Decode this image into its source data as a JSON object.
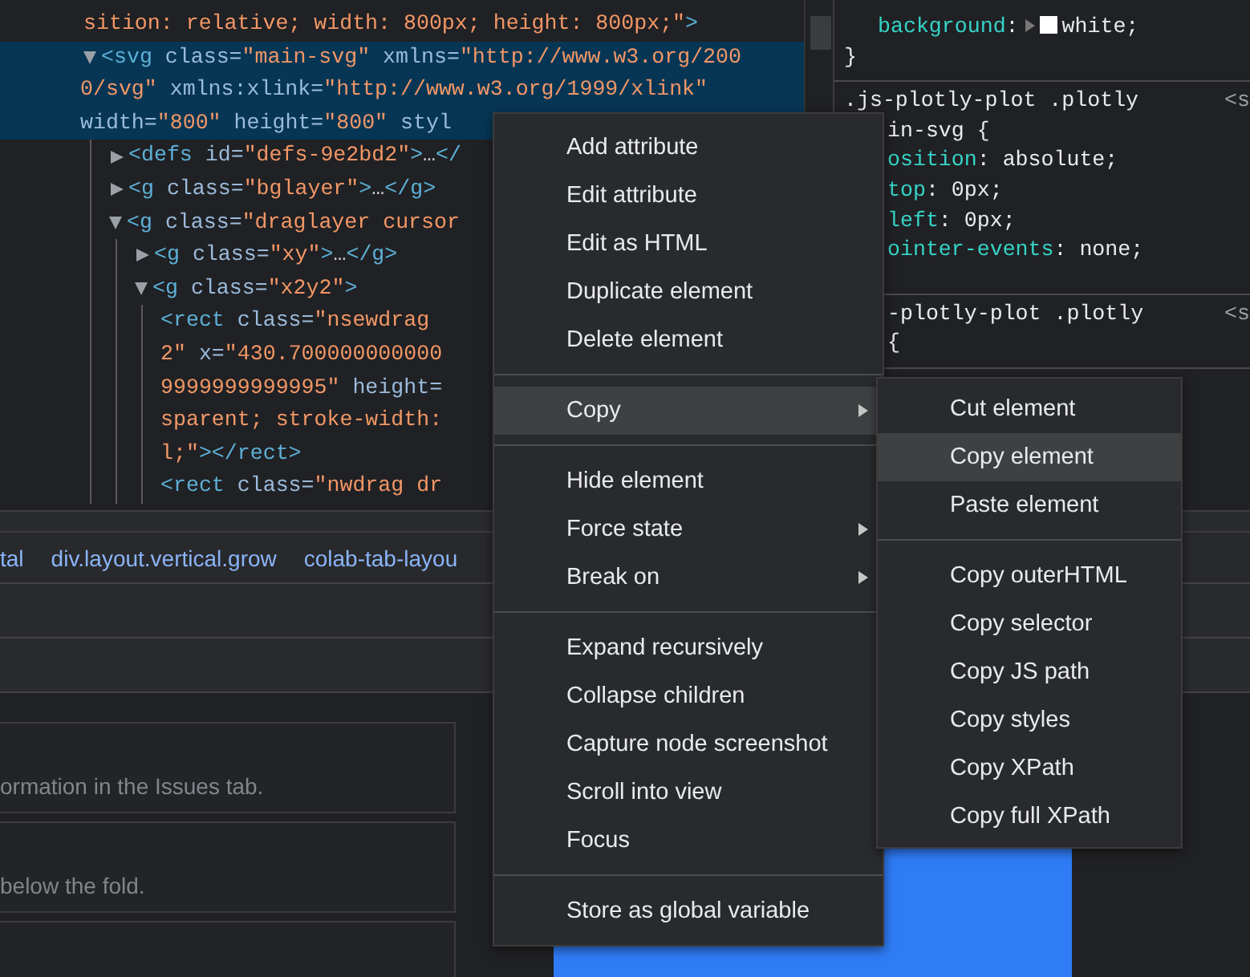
{
  "elements_panel": {
    "nodes": [
      {
        "selected": false,
        "lines": [
          [
            {
              "kind": "value",
              "t": "sition: relative; width: 800px; height: 800px;\""
            },
            {
              "kind": "tag",
              "t": ">"
            }
          ]
        ],
        "children": [
          {
            "expanded": true,
            "selected": true,
            "lines": [
              [
                {
                  "kind": "tag",
                  "t": "<svg"
                },
                {
                  "kind": "attr",
                  "t": " class="
                },
                {
                  "kind": "value",
                  "t": "\"main-svg\""
                },
                {
                  "kind": "attr",
                  "t": " xmlns="
                },
                {
                  "kind": "value",
                  "t": "\"http://www.w3.org/200"
                }
              ],
              [
                {
                  "kind": "value",
                  "t": "0/svg\""
                },
                {
                  "kind": "attr",
                  "t": " xmlns:xlink="
                },
                {
                  "kind": "value",
                  "t": "\"http://www.w3.org/1999/xlink\""
                }
              ],
              [
                {
                  "kind": "attr",
                  "t": "width="
                },
                {
                  "kind": "value",
                  "t": "\"800\""
                },
                {
                  "kind": "attr",
                  "t": " height="
                },
                {
                  "kind": "value",
                  "t": "\"800\""
                },
                {
                  "kind": "attr",
                  "t": " styl"
                }
              ]
            ],
            "children": [
              {
                "expanded": false,
                "selected": false,
                "lines": [
                  [
                    {
                      "kind": "tag",
                      "t": "<defs"
                    },
                    {
                      "kind": "attr",
                      "t": " id="
                    },
                    {
                      "kind": "value",
                      "t": "\"defs-9e2bd2\""
                    },
                    {
                      "kind": "tag",
                      "t": ">"
                    },
                    {
                      "kind": "ellipsis",
                      "t": "…"
                    },
                    {
                      "kind": "tag",
                      "t": "</"
                    }
                  ]
                ]
              },
              {
                "expanded": false,
                "selected": false,
                "lines": [
                  [
                    {
                      "kind": "tag",
                      "t": "<g"
                    },
                    {
                      "kind": "attr",
                      "t": " class="
                    },
                    {
                      "kind": "value",
                      "t": "\"bglayer\""
                    },
                    {
                      "kind": "tag",
                      "t": ">"
                    },
                    {
                      "kind": "ellipsis",
                      "t": "…"
                    },
                    {
                      "kind": "tag",
                      "t": "</g>"
                    }
                  ]
                ]
              },
              {
                "expanded": true,
                "selected": false,
                "lines": [
                  [
                    {
                      "kind": "tag",
                      "t": "<g"
                    },
                    {
                      "kind": "attr",
                      "t": " class="
                    },
                    {
                      "kind": "value",
                      "t": "\"draglayer cursor"
                    }
                  ]
                ],
                "children": [
                  {
                    "expanded": false,
                    "selected": false,
                    "lines": [
                      [
                        {
                          "kind": "tag",
                          "t": "<g"
                        },
                        {
                          "kind": "attr",
                          "t": " class="
                        },
                        {
                          "kind": "value",
                          "t": "\"xy\""
                        },
                        {
                          "kind": "tag",
                          "t": ">"
                        },
                        {
                          "kind": "ellipsis",
                          "t": "…"
                        },
                        {
                          "kind": "tag",
                          "t": "</g>"
                        }
                      ]
                    ]
                  },
                  {
                    "expanded": true,
                    "selected": false,
                    "lines": [
                      [
                        {
                          "kind": "tag",
                          "t": "<g"
                        },
                        {
                          "kind": "attr",
                          "t": " class="
                        },
                        {
                          "kind": "value",
                          "t": "\"x2y2\""
                        },
                        {
                          "kind": "tag",
                          "t": ">"
                        }
                      ]
                    ],
                    "children": [
                      {
                        "selected": false,
                        "lines": [
                          [
                            {
                              "kind": "tag",
                              "t": "<rect"
                            },
                            {
                              "kind": "attr",
                              "t": " class="
                            },
                            {
                              "kind": "value",
                              "t": "\"nsewdrag"
                            }
                          ],
                          [
                            {
                              "kind": "value",
                              "t": "2\""
                            },
                            {
                              "kind": "attr",
                              "t": " x="
                            },
                            {
                              "kind": "value",
                              "t": "\"430.700000000000"
                            }
                          ],
                          [
                            {
                              "kind": "value",
                              "t": "9999999999995\""
                            },
                            {
                              "kind": "attr",
                              "t": " height="
                            }
                          ],
                          [
                            {
                              "kind": "value",
                              "t": "sparent; stroke-width:"
                            }
                          ],
                          [
                            {
                              "kind": "value",
                              "t": "l;\""
                            },
                            {
                              "kind": "tag",
                              "t": "></rect>"
                            }
                          ]
                        ]
                      },
                      {
                        "selected": false,
                        "lines": [
                          [
                            {
                              "kind": "tag",
                              "t": "<rect"
                            },
                            {
                              "kind": "attr",
                              "t": " class="
                            },
                            {
                              "kind": "value",
                              "t": "\"nwdrag dr"
                            }
                          ]
                        ]
                      }
                    ]
                  }
                ]
              }
            ]
          }
        ]
      }
    ]
  },
  "styles_panel": {
    "sections": [
      {
        "lines": [
          {
            "kind": "rule",
            "tokens": [
              {
                "kind": "property",
                "t": "background"
              },
              {
                "kind": "plain",
                "t": ":"
              },
              {
                "kind": "swatch"
              },
              {
                "kind": "plain",
                "t": "white;"
              }
            ]
          },
          {
            "kind": "rule",
            "tokens": [
              {
                "kind": "plain",
                "t": "}"
              }
            ]
          }
        ]
      },
      {
        "lines": [
          {
            "kind": "rule",
            "tokens": [
              {
                "kind": "selector",
                "t": ".js-plotly-plot .plotly"
              }
            ],
            "source": "<s"
          },
          {
            "kind": "clipped",
            "tokens": [
              {
                "kind": "selector",
                "t": "in-svg {"
              }
            ]
          },
          {
            "kind": "clipped",
            "tokens": [
              {
                "kind": "property",
                "t": "osition"
              },
              {
                "kind": "plain",
                "t": ": absolute;"
              }
            ]
          },
          {
            "kind": "clipped",
            "tokens": [
              {
                "kind": "property",
                "t": "top"
              },
              {
                "kind": "plain",
                "t": ": 0px;"
              }
            ]
          },
          {
            "kind": "clipped",
            "tokens": [
              {
                "kind": "property",
                "t": "left"
              },
              {
                "kind": "plain",
                "t": ": 0px;"
              }
            ]
          },
          {
            "kind": "clipped",
            "tokens": [
              {
                "kind": "property",
                "t": "ointer-events"
              },
              {
                "kind": "plain",
                "t": ": none;"
              }
            ]
          }
        ]
      },
      {
        "lines": [
          {
            "kind": "clipped",
            "tokens": [
              {
                "kind": "selector",
                "t": "-plotly-plot .plotly"
              }
            ],
            "source": "<s"
          },
          {
            "kind": "clipped",
            "tokens": [
              {
                "kind": "plain",
                "t": "{"
              }
            ]
          }
        ]
      }
    ]
  },
  "breadcrumbs": [
    {
      "label": "tal"
    },
    {
      "label": "div.layout.vertical.grow"
    },
    {
      "label": "colab-tab-layou"
    }
  ],
  "messages": [
    {
      "kind": "message",
      "text": "ormation in the Issues tab."
    },
    {
      "kind": "message",
      "text": "below the fold."
    },
    {
      "kind": "blank"
    }
  ],
  "context_menu": {
    "groups": [
      [
        {
          "label": "Add attribute",
          "selected": false,
          "has_submenu": false
        },
        {
          "label": "Edit attribute",
          "selected": false,
          "has_submenu": false
        },
        {
          "label": "Edit as HTML",
          "selected": false,
          "has_submenu": false
        },
        {
          "label": "Duplicate element",
          "selected": false,
          "has_submenu": false
        },
        {
          "label": "Delete element",
          "selected": false,
          "has_submenu": false
        }
      ],
      [
        {
          "label": "Copy",
          "selected": true,
          "has_submenu": true,
          "submenu": {
            "groups": [
              [
                {
                  "label": "Cut element",
                  "selected": false,
                  "has_submenu": false
                },
                {
                  "label": "Copy element",
                  "selected": true,
                  "has_submenu": false
                },
                {
                  "label": "Paste element",
                  "selected": false,
                  "has_submenu": false
                }
              ],
              [
                {
                  "label": "Copy outerHTML",
                  "selected": false,
                  "has_submenu": false
                },
                {
                  "label": "Copy selector",
                  "selected": false,
                  "has_submenu": false
                },
                {
                  "label": "Copy JS path",
                  "selected": false,
                  "has_submenu": false
                },
                {
                  "label": "Copy styles",
                  "selected": false,
                  "has_submenu": false
                },
                {
                  "label": "Copy XPath",
                  "selected": false,
                  "has_submenu": false
                },
                {
                  "label": "Copy full XPath",
                  "selected": false,
                  "has_submenu": false
                }
              ]
            ]
          }
        }
      ],
      [
        {
          "label": "Hide element",
          "selected": false,
          "has_submenu": false
        },
        {
          "label": "Force state",
          "selected": false,
          "has_submenu": true
        },
        {
          "label": "Break on",
          "selected": false,
          "has_submenu": true
        }
      ],
      [
        {
          "label": "Expand recursively",
          "selected": false,
          "has_submenu": false
        },
        {
          "label": "Collapse children",
          "selected": false,
          "has_submenu": false
        },
        {
          "label": "Capture node screenshot",
          "selected": false,
          "has_submenu": false
        },
        {
          "label": "Scroll into view",
          "selected": false,
          "has_submenu": false
        },
        {
          "label": "Focus",
          "selected": false,
          "has_submenu": false
        }
      ],
      [
        {
          "label": "Store as global variable",
          "selected": false,
          "has_submenu": false
        }
      ]
    ]
  }
}
